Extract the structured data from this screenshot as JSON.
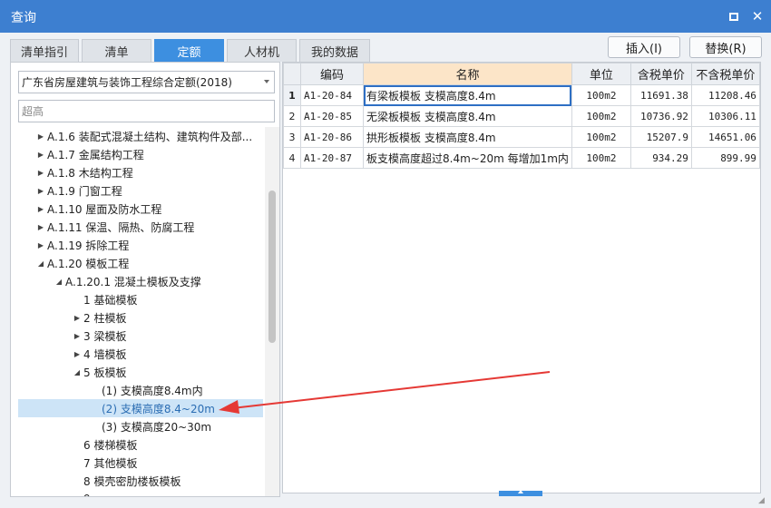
{
  "window": {
    "title": "查询"
  },
  "tabs": [
    {
      "label": "清单指引",
      "active": false
    },
    {
      "label": "清单",
      "active": false
    },
    {
      "label": "定额",
      "active": true
    },
    {
      "label": "人材机",
      "active": false
    },
    {
      "label": "我的数据",
      "active": false
    }
  ],
  "buttons": {
    "insert": "插入(I)",
    "replace": "替换(R)"
  },
  "library": {
    "selected": "广东省房屋建筑与装饰工程综合定额(2018)"
  },
  "search": {
    "value": "超高"
  },
  "tree": [
    {
      "label": "A.1.6 装配式混凝土结构、建筑构件及部...",
      "toggle": "collapsed",
      "selected": false
    },
    {
      "label": "A.1.7 金属结构工程",
      "toggle": "collapsed",
      "selected": false
    },
    {
      "label": "A.1.8 木结构工程",
      "toggle": "collapsed",
      "selected": false
    },
    {
      "label": "A.1.9 门窗工程",
      "toggle": "collapsed",
      "selected": false
    },
    {
      "label": "A.1.10 屋面及防水工程",
      "toggle": "collapsed",
      "selected": false
    },
    {
      "label": "A.1.11 保温、隔热、防腐工程",
      "toggle": "collapsed",
      "selected": false
    },
    {
      "label": "A.1.19 拆除工程",
      "toggle": "collapsed",
      "selected": false
    },
    {
      "label": "A.1.20 模板工程",
      "toggle": "expanded",
      "selected": false
    },
    {
      "label": "A.1.20.1 混凝土模板及支撑",
      "toggle": "expanded",
      "selected": false
    },
    {
      "label": "1 基础模板",
      "toggle": "none",
      "selected": false
    },
    {
      "label": "2 柱模板",
      "toggle": "collapsed",
      "selected": false
    },
    {
      "label": "3 梁模板",
      "toggle": "collapsed",
      "selected": false
    },
    {
      "label": "4 墙模板",
      "toggle": "collapsed",
      "selected": false
    },
    {
      "label": "5 板模板",
      "toggle": "expanded",
      "selected": false
    },
    {
      "label": "(1) 支模高度8.4m内",
      "toggle": "none",
      "selected": false
    },
    {
      "label": "(2) 支模高度8.4~20m",
      "toggle": "none",
      "selected": true
    },
    {
      "label": "(3) 支模高度20~30m",
      "toggle": "none",
      "selected": false
    },
    {
      "label": "6 楼梯模板",
      "toggle": "none",
      "selected": false
    },
    {
      "label": "7 其他模板",
      "toggle": "none",
      "selected": false
    },
    {
      "label": "8 模壳密肋楼板模板",
      "toggle": "none",
      "selected": false
    },
    {
      "label": "9 ...",
      "toggle": "none",
      "selected": false
    }
  ],
  "table": {
    "headers": [
      "",
      "编码",
      "名称",
      "单位",
      "含税单价",
      "不含税单价"
    ],
    "rows": [
      {
        "index": "1",
        "code": "A1-20-84",
        "name": "有梁板模板 支模高度8.4m",
        "unit": "100m2",
        "price_tax": "11691.38",
        "price_notax": "11208.46"
      },
      {
        "index": "2",
        "code": "A1-20-85",
        "name": "无梁板模板 支模高度8.4m",
        "unit": "100m2",
        "price_tax": "10736.92",
        "price_notax": "10306.11"
      },
      {
        "index": "3",
        "code": "A1-20-86",
        "name": "拱形板模板 支模高度8.4m",
        "unit": "100m2",
        "price_tax": "15207.9",
        "price_notax": "14651.06"
      },
      {
        "index": "4",
        "code": "A1-20-87",
        "name": "板支模高度超过8.4m~20m 每增加1m内",
        "unit": "100m2",
        "price_tax": "934.29",
        "price_notax": "899.99"
      }
    ]
  },
  "colors": {
    "titlebar": "#3d7fd0",
    "tab_active": "#3d8fe0",
    "selection": "#cde4f7",
    "annotation_arrow": "#e53935"
  }
}
